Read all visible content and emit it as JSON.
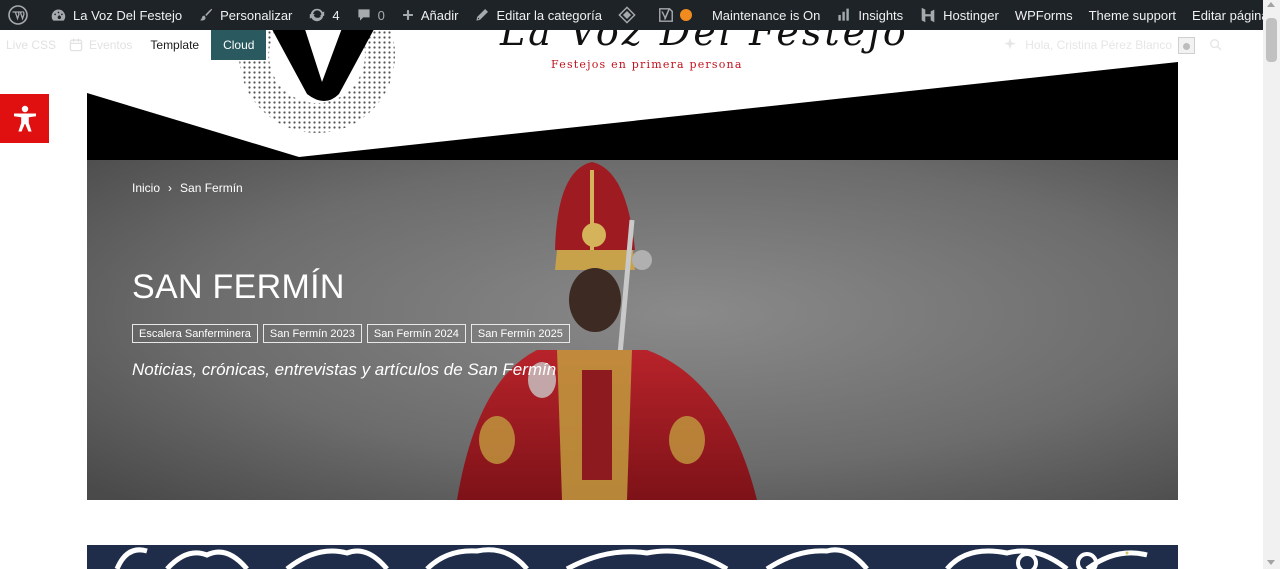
{
  "adminbar": {
    "site_name": "La Voz Del Festejo",
    "customize": "Personalizar",
    "updates_count": "4",
    "comments_count": "0",
    "add_new": "Añadir",
    "edit_category": "Editar la categoría",
    "maintenance": "Maintenance is On",
    "insights": "Insights",
    "hostinger": "Hostinger",
    "wpforms": "WPForms",
    "theme_support": "Theme support",
    "edit_home": "Editar página de inicio"
  },
  "header": {
    "tagline": "Festejos en primera persona",
    "logo_text": "La Voz Del Festejo",
    "nav": {
      "live_css": "Live CSS",
      "eventos": "Eventos",
      "template": "Template",
      "cloud": "Cloud"
    },
    "greeting": "Hola, Cristina Pérez Blanco"
  },
  "hero": {
    "breadcrumb_home": "Inicio",
    "breadcrumb_sep": "›",
    "breadcrumb_current": "San Fermín",
    "title": "SAN FERMÍN",
    "tags": [
      "Escalera Sanferminera",
      "San Fermín 2023",
      "San Fermín 2024",
      "San Fermín 2025"
    ],
    "description": "Noticias, crónicas, entrevistas y artículos de San Fermín"
  },
  "colors": {
    "adminbar": "#1d2327",
    "cloud": "#2a5a5f",
    "accessibility": "#e01010",
    "tagline": "#c1121f",
    "banner": "#1f2d4b"
  }
}
